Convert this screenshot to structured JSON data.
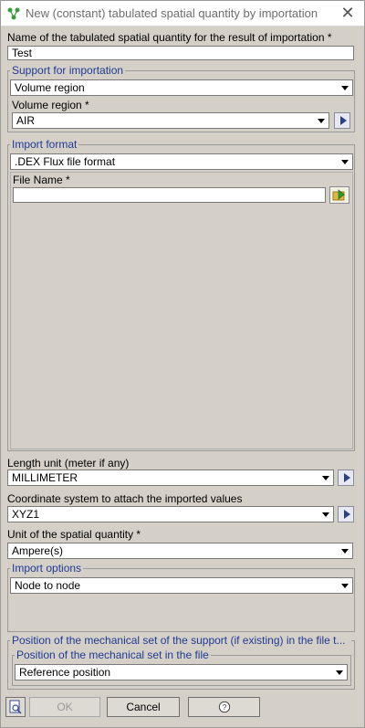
{
  "window": {
    "title": "New (constant) tabulated spatial quantity by importation",
    "close_glyph": "✕",
    "app_icon": "network-nodes-icon"
  },
  "name_field": {
    "label": "Name of the tabulated spatial quantity for the result of importation *",
    "value": "Test"
  },
  "support": {
    "group_title": "Support for importation",
    "type_value": "Volume region",
    "region_label": "Volume region *",
    "region_value": "AIR"
  },
  "import_format": {
    "group_title": "Import format",
    "format_value": ".DEX Flux file format",
    "file_label": "File Name *",
    "file_value": "",
    "file_icon": "open-file-icon"
  },
  "length_unit": {
    "label": "Length unit (meter if any)",
    "value": "MILLIMETER"
  },
  "coordinate_system": {
    "label": "Coordinate system to attach the imported values",
    "value": "XYZ1"
  },
  "spatial_unit": {
    "label": "Unit of the spatial quantity *",
    "value": "Ampere(s)"
  },
  "import_options": {
    "group_title": "Import options",
    "value": "Node to node"
  },
  "mechanical_position": {
    "outer_title": "Position of the mechanical set of the support (if existing) in the file t...",
    "inner_title": "Position of the mechanical set in the file",
    "value": "Reference position"
  },
  "buttons": {
    "ok": "OK",
    "cancel": "Cancel",
    "help_icon": "help-icon",
    "preview_icon": "preview-icon"
  }
}
